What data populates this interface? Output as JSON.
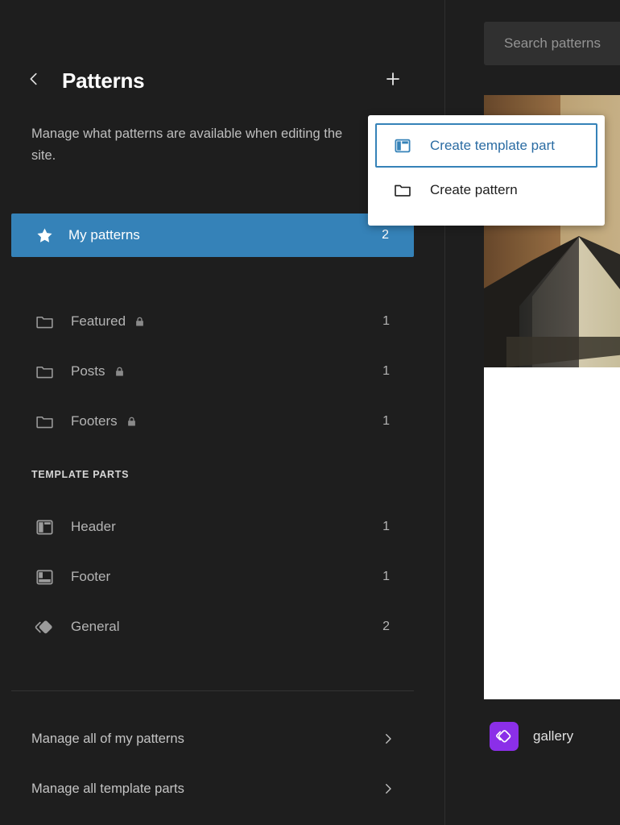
{
  "sidebar": {
    "back_icon": "chevron-left-icon",
    "title": "Patterns",
    "add_icon": "plus-icon",
    "description": "Manage what patterns are available when editing the site.",
    "my_patterns": {
      "icon": "star-icon",
      "label": "My patterns",
      "count": "2"
    },
    "categories": [
      {
        "icon": "folder-icon",
        "label": "Featured",
        "locked": true,
        "count": "1"
      },
      {
        "icon": "folder-icon",
        "label": "Posts",
        "locked": true,
        "count": "1"
      },
      {
        "icon": "folder-icon",
        "label": "Footers",
        "locked": true,
        "count": "1"
      }
    ],
    "template_parts_heading": "TEMPLATE PARTS",
    "template_parts": [
      {
        "icon": "header-layout-icon",
        "label": "Header",
        "count": "1"
      },
      {
        "icon": "footer-layout-icon",
        "label": "Footer",
        "count": "1"
      },
      {
        "icon": "symbol-icon",
        "label": "General",
        "count": "2"
      }
    ],
    "footer_links": [
      {
        "label": "Manage all of my patterns",
        "chevron": "chevron-right-icon"
      },
      {
        "label": "Manage all template parts",
        "chevron": "chevron-right-icon"
      }
    ]
  },
  "dropdown": {
    "items": [
      {
        "icon": "template-part-icon",
        "label": "Create template part",
        "focused": true
      },
      {
        "icon": "folder-icon",
        "label": "Create pattern",
        "focused": false
      }
    ]
  },
  "right_panel": {
    "search_placeholder": "Search patterns",
    "pattern": {
      "badge_icon": "symbol-icon",
      "title": "gallery"
    }
  },
  "colors": {
    "accent_blue": "#3582b8",
    "menu_link_blue": "#2b6ca3",
    "badge_purple": "#8b2fe8",
    "background": "#1e1e1e",
    "search_field": "#303030"
  }
}
